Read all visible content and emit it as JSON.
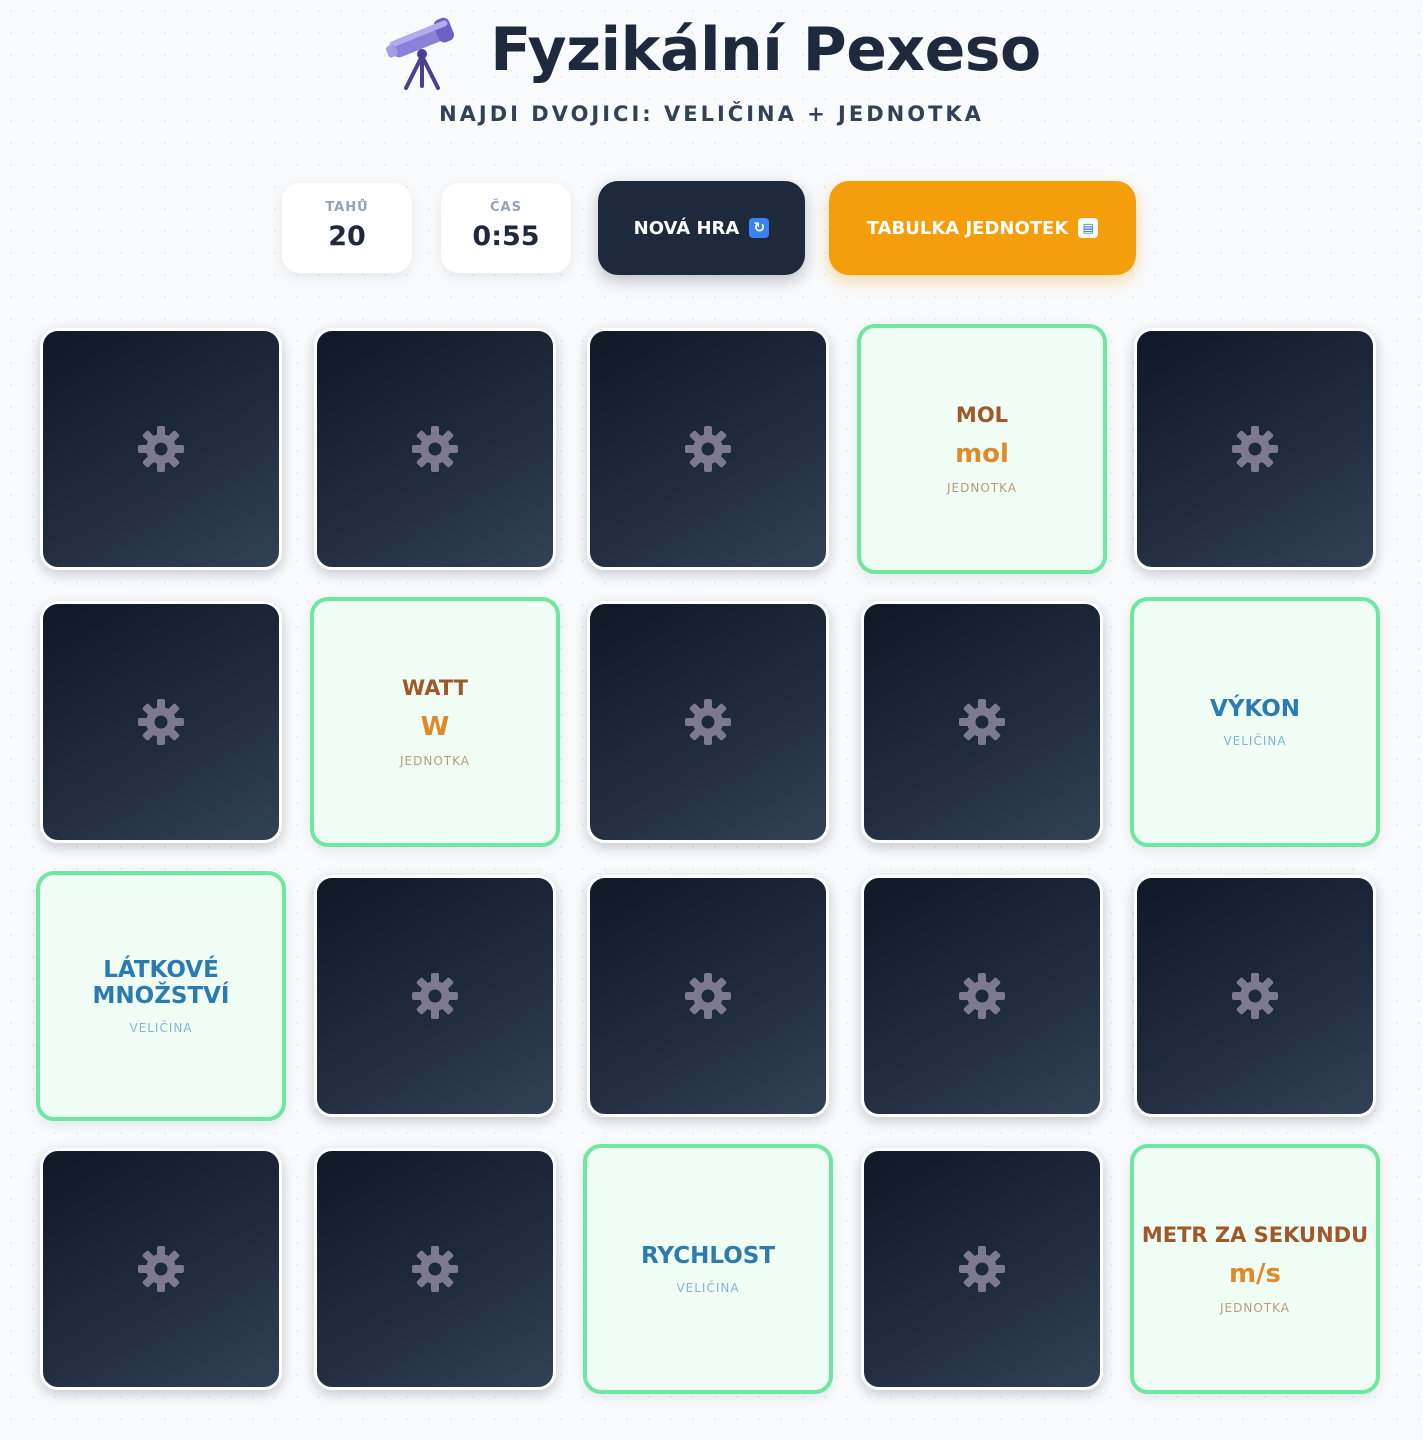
{
  "header": {
    "title": "Fyzikální Pexeso",
    "subtitle": "NAJDI DVOJICI: VELIČINA + JEDNOTKA",
    "logo_icon": "telescope-icon"
  },
  "stats": {
    "moves_label": "TAHŮ",
    "moves_value": "20",
    "time_label": "ČAS",
    "time_value": "0:55"
  },
  "buttons": {
    "new_game_label": "NOVÁ HRA",
    "new_game_icon": "🔄",
    "units_table_label": "TABULKA JEDNOTEK",
    "units_table_icon": "📖"
  },
  "colors": {
    "primary_dark": "#1e293b",
    "accent_orange": "#f59e0b",
    "matched_border": "#6ee7a0",
    "matched_bg": "#f0fdf4",
    "quantity_text": "#2b7bb0",
    "unit_text": "#a0572a",
    "unit_symbol": "#e0892b"
  },
  "board": {
    "card_back_icon": "gear-icon",
    "cards": [
      {
        "state": "hidden"
      },
      {
        "state": "hidden"
      },
      {
        "state": "hidden"
      },
      {
        "state": "matched",
        "kind": "unit",
        "name": "MOL",
        "symbol": "mol",
        "type_label": "JEDNOTKA"
      },
      {
        "state": "hidden"
      },
      {
        "state": "hidden"
      },
      {
        "state": "matched",
        "kind": "unit",
        "name": "WATT",
        "symbol": "W",
        "type_label": "JEDNOTKA"
      },
      {
        "state": "hidden"
      },
      {
        "state": "hidden"
      },
      {
        "state": "matched",
        "kind": "quantity",
        "name": "VÝKON",
        "type_label": "VELIČINA"
      },
      {
        "state": "matched",
        "kind": "quantity",
        "name": "LÁTKOVÉ MNOŽSTVÍ",
        "type_label": "VELIČINA"
      },
      {
        "state": "hidden"
      },
      {
        "state": "hidden"
      },
      {
        "state": "hidden"
      },
      {
        "state": "hidden"
      },
      {
        "state": "hidden"
      },
      {
        "state": "hidden"
      },
      {
        "state": "matched",
        "kind": "quantity",
        "name": "RYCHLOST",
        "type_label": "VELIČINA"
      },
      {
        "state": "hidden"
      },
      {
        "state": "matched",
        "kind": "unit",
        "name": "METR ZA SEKUNDU",
        "symbol": "m/s",
        "type_label": "JEDNOTKA"
      }
    ]
  }
}
